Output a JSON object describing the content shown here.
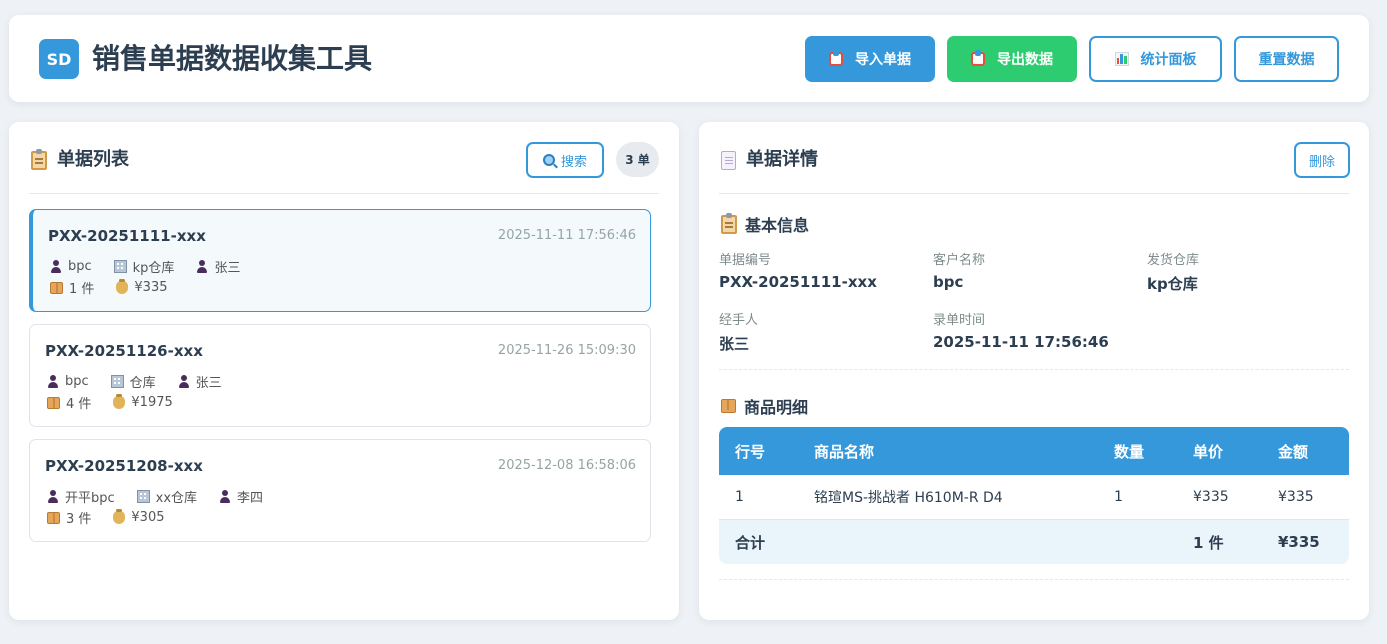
{
  "header": {
    "logo_text": "SD",
    "title": "销售单据数据收集工具",
    "buttons": {
      "import": "导入单据",
      "export": "导出数据",
      "stats": "统计面板",
      "reset": "重置数据"
    }
  },
  "list_panel": {
    "title": "单据列表",
    "search_label": "搜索",
    "count_badge": "3 单",
    "orders": [
      {
        "id": "PXX-20251111-xxx",
        "time": "2025-11-11 17:56:46",
        "customer": "bpc",
        "warehouse": "kp仓库",
        "handler": "张三",
        "qty": "1 件",
        "amount": "¥335"
      },
      {
        "id": "PXX-20251126-xxx",
        "time": "2025-11-26 15:09:30",
        "customer": "bpc",
        "warehouse": "仓库",
        "handler": "张三",
        "qty": "4 件",
        "amount": "¥1975"
      },
      {
        "id": "PXX-20251208-xxx",
        "time": "2025-12-08 16:58:06",
        "customer": "开平bpc",
        "warehouse": "xx仓库",
        "handler": "李四",
        "qty": "3 件",
        "amount": "¥305"
      }
    ]
  },
  "detail_panel": {
    "title": "单据详情",
    "delete_label": "删除",
    "basic_info": {
      "title": "基本信息",
      "fields": {
        "order_no_label": "单据编号",
        "order_no": "PXX-20251111-xxx",
        "customer_label": "客户名称",
        "customer": "bpc",
        "warehouse_label": "发货仓库",
        "warehouse": "kp仓库",
        "handler_label": "经手人",
        "handler": "张三",
        "time_label": "录单时间",
        "time": "2025-11-11 17:56:46"
      }
    },
    "items": {
      "title": "商品明细",
      "columns": [
        "行号",
        "商品名称",
        "数量",
        "单价",
        "金额"
      ],
      "rows": [
        [
          "1",
          "铭瑄MS-挑战者 H610M-R D4",
          "1",
          "¥335",
          "¥335"
        ]
      ],
      "total": {
        "label": "合计",
        "qty": "1 件",
        "amount": "¥335"
      }
    }
  },
  "colors": {
    "primary": "#3498db",
    "success": "#2ecc71",
    "text": "#2c3e50",
    "muted": "#95a5a6",
    "background": "#eef2f6"
  }
}
